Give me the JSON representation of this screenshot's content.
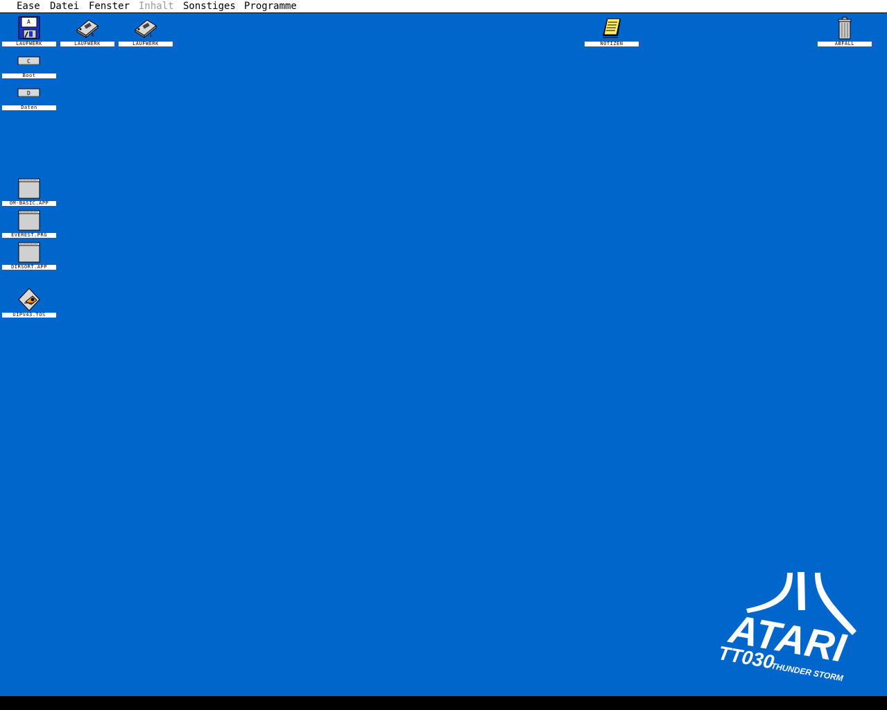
{
  "menubar": {
    "items": [
      {
        "label": "Ease",
        "enabled": true
      },
      {
        "label": "Datei",
        "enabled": true
      },
      {
        "label": "Fenster",
        "enabled": true
      },
      {
        "label": "Inhalt",
        "enabled": false
      },
      {
        "label": "Sonstiges",
        "enabled": true
      },
      {
        "label": "Programme",
        "enabled": true
      }
    ]
  },
  "desktop": {
    "icons": [
      {
        "label": "LAUFWERK",
        "icon": "floppy-drive-icon",
        "letter": "A"
      },
      {
        "label": "LAUFWERK",
        "icon": "removable-drive-icon",
        "letter": "K"
      },
      {
        "label": "LAUFWERK",
        "icon": "removable-drive-icon",
        "letter": "L"
      },
      {
        "label": "NOTIZEN",
        "icon": "notepad-icon"
      },
      {
        "label": "ABFALL",
        "icon": "trash-icon"
      },
      {
        "label": "Boot",
        "icon": "hard-drive-icon",
        "letter": "C"
      },
      {
        "label": "Daten",
        "icon": "hard-drive-icon",
        "letter": "D"
      },
      {
        "label": "OM-BASIC.APP",
        "icon": "application-icon"
      },
      {
        "label": "EVEREST.PRG",
        "icon": "application-icon"
      },
      {
        "label": "DIRSORT.APP",
        "icon": "application-icon"
      },
      {
        "label": "UIPV43.TOS",
        "icon": "tos-program-icon"
      }
    ]
  },
  "logo": {
    "brand": "ATARI",
    "model": "TT030",
    "tagline": "THUNDER STORM"
  },
  "colors": {
    "desktop": "#0066cc",
    "menubar": "#ffffff",
    "bottom_bar": "#000000"
  }
}
